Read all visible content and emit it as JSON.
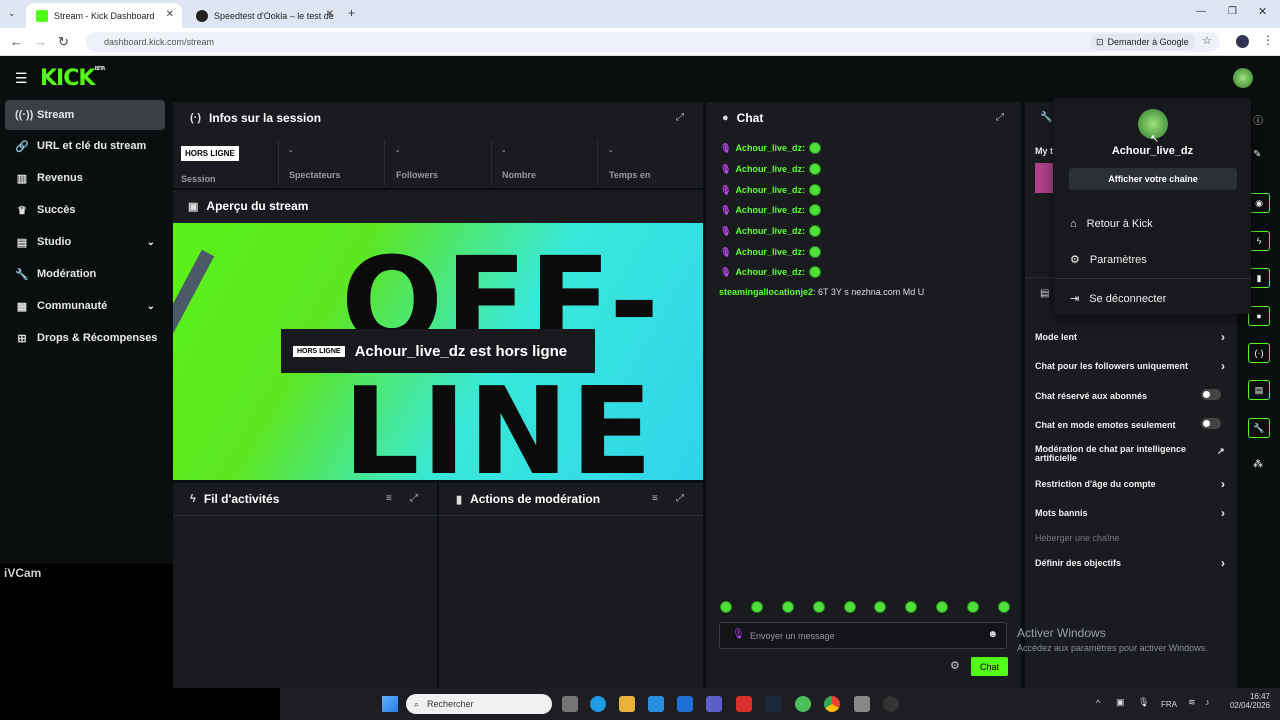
{
  "browser": {
    "tabs": [
      {
        "title": "Stream - Kick Dashboard"
      },
      {
        "title": "Speedtest d'Ookla – le test de"
      }
    ],
    "url": "dashboard.kick.com/stream",
    "ask_google": "Demander à Google"
  },
  "app": {
    "logo": "KICK",
    "logo_badge": "BETA"
  },
  "sidebar": {
    "items": [
      {
        "label": "Stream"
      },
      {
        "label": "URL et clé du stream"
      },
      {
        "label": "Revenus"
      },
      {
        "label": "Succès"
      },
      {
        "label": "Studio"
      },
      {
        "label": "Modération"
      },
      {
        "label": "Communauté"
      },
      {
        "label": "Drops & Récompenses"
      }
    ]
  },
  "session": {
    "title": "Infos sur la session",
    "badge": "HORS LIGNE",
    "stats": [
      {
        "value": "",
        "label": "Session"
      },
      {
        "value": "-",
        "label": "Spectateurs"
      },
      {
        "value": "-",
        "label": "Followers"
      },
      {
        "value": "-",
        "label": "Nombre"
      },
      {
        "value": "-",
        "label": "Temps en"
      }
    ]
  },
  "preview": {
    "title": "Aperçu du stream",
    "bg_text_1": "OFF-",
    "bg_text_2": "LINE",
    "badge": "HORS LIGNE",
    "message": "Achour_live_dz est hors ligne"
  },
  "activity": {
    "title": "Fil d'activités"
  },
  "modactions": {
    "title": "Actions de modération"
  },
  "webcam": {
    "label": "iVCam"
  },
  "chat": {
    "title": "Chat",
    "messages": [
      {
        "user": "Achour_live_dz:"
      },
      {
        "user": "Achour_live_dz:"
      },
      {
        "user": "Achour_live_dz:"
      },
      {
        "user": "Achour_live_dz:"
      },
      {
        "user": "Achour_live_dz:"
      },
      {
        "user": "Achour_live_dz:"
      },
      {
        "user": "Achour_live_dz:"
      }
    ],
    "last_user": "steamingallocationje2",
    "last_text": ": 6T 3Y s nezhna.com Md U",
    "input_placeholder": "Envoyer un message",
    "send_label": "Chat"
  },
  "mod_settings": {
    "partial_label": "My t",
    "rows": [
      {
        "label": "Mode lent",
        "control": "arrow"
      },
      {
        "label": "Chat pour les followers uniquement",
        "control": "arrow"
      },
      {
        "label": "Chat réservé aux abonnés",
        "control": "toggle"
      },
      {
        "label": "Chat en mode emotes seulement",
        "control": "toggle"
      },
      {
        "label": "Modération de chat par intelligence artificielle",
        "control": "external"
      },
      {
        "label": "Restriction d'âge du compte",
        "control": "arrow"
      },
      {
        "label": "Mots bannis",
        "control": "arrow"
      },
      {
        "label": "Héberger une chaîne",
        "control": "disabled"
      },
      {
        "label": "Définir des objectifs",
        "control": "arrow"
      }
    ]
  },
  "user_menu": {
    "username": "Achour_live_dz",
    "view_channel": "Afficher votre chaîne",
    "items": [
      {
        "label": "Retour à Kick"
      },
      {
        "label": "Paramètres"
      },
      {
        "label": "Se déconnecter"
      }
    ]
  },
  "windows": {
    "activate_title": "Activer Windows",
    "activate_sub": "Accédez aux paramètres pour activer Windows.",
    "search": "Rechercher",
    "lang": "FRA",
    "time": "16:47",
    "date": "02/04/2026"
  },
  "colors": {
    "accent": "#53fc18",
    "panel": "#191b1f",
    "bg": "#0b0e0f"
  }
}
